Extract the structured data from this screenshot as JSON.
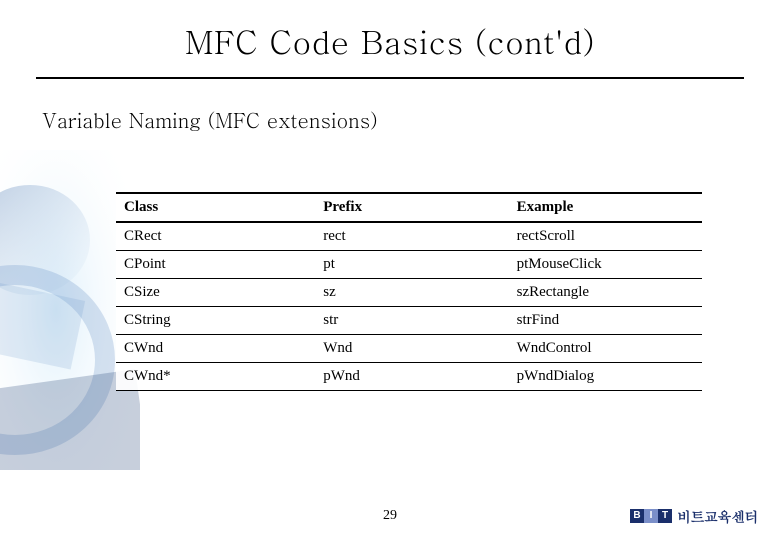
{
  "title": "MFC Code Basics (cont'd)",
  "subtitle": "Variable Naming (MFC extensions)",
  "table": {
    "headers": [
      "Class",
      "Prefix",
      "Example"
    ],
    "rows": [
      [
        "CRect",
        "rect",
        "rectScroll"
      ],
      [
        "CPoint",
        "pt",
        "ptMouseClick"
      ],
      [
        "CSize",
        "sz",
        "szRectangle"
      ],
      [
        "CString",
        "str",
        "strFind"
      ],
      [
        "CWnd",
        "Wnd",
        "WndControl"
      ],
      [
        "CWnd*",
        "pWnd",
        "pWndDialog"
      ]
    ]
  },
  "page_number": "29",
  "brand": {
    "logo_letters": [
      "B",
      "I",
      "T"
    ],
    "text": "비트교육센터"
  },
  "colors": {
    "brand_dark": "#1a2f6b",
    "brand_light": "#7b8fc9"
  }
}
